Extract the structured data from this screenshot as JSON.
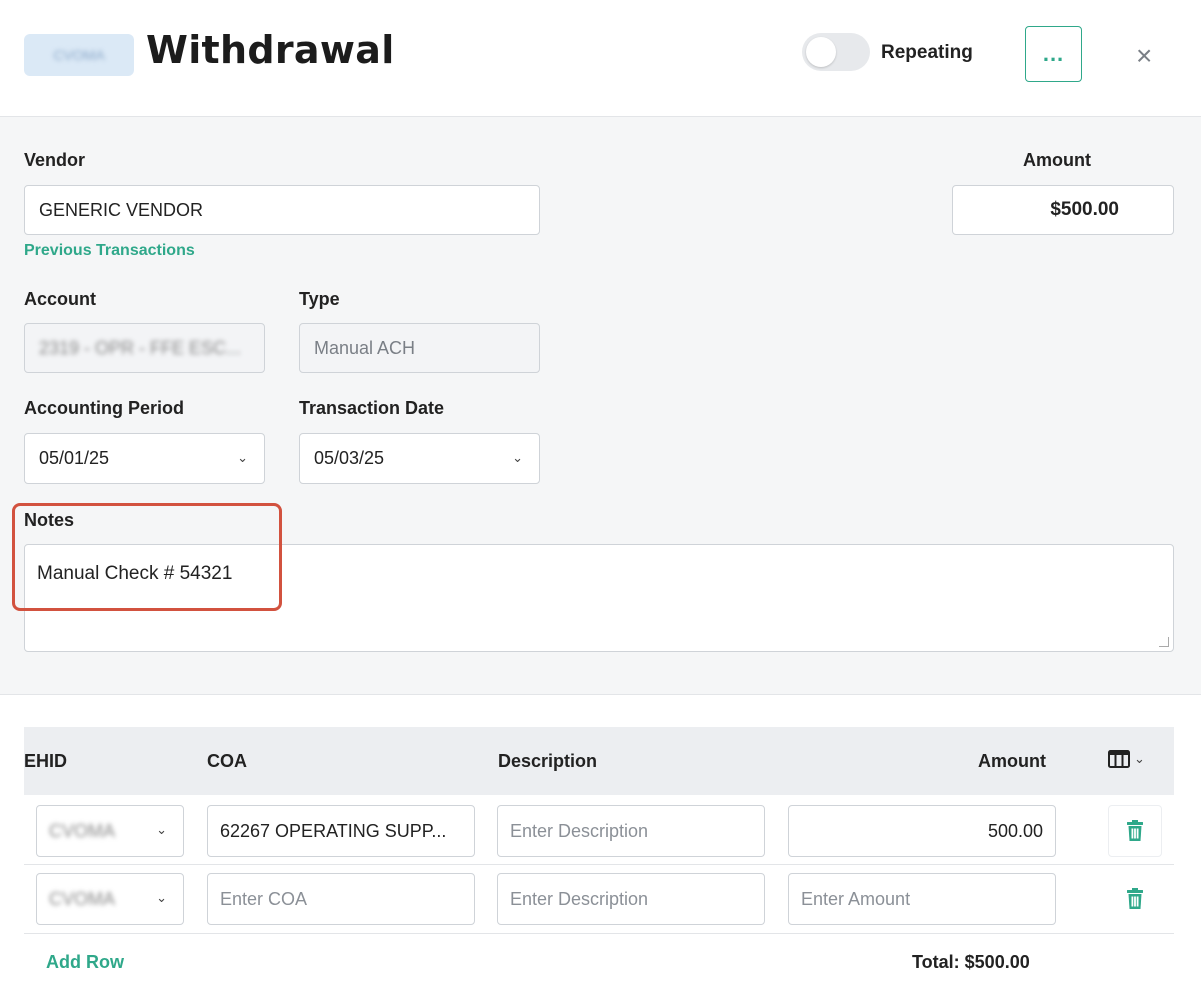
{
  "header": {
    "badge_text": "CVOMA",
    "title": "Withdrawal",
    "repeating_label": "Repeating",
    "repeating_on": false,
    "more_label": "...",
    "close_label": "×"
  },
  "form": {
    "vendor_label": "Vendor",
    "vendor_value": "GENERIC VENDOR",
    "previous_transactions": "Previous Transactions",
    "amount_label": "Amount",
    "amount_value": "$500.00",
    "account_label": "Account",
    "account_value": "2319 - OPR - FFE ESC...",
    "type_label": "Type",
    "type_value": "Manual ACH",
    "accounting_period_label": "Accounting Period",
    "accounting_period_value": "05/01/25",
    "transaction_date_label": "Transaction Date",
    "transaction_date_value": "05/03/25",
    "notes_label": "Notes",
    "notes_value": "Manual Check # 54321"
  },
  "table": {
    "headers": {
      "ehid": "EHID",
      "coa": "COA",
      "description": "Description",
      "amount": "Amount"
    },
    "rows": [
      {
        "ehid": "CVOMA",
        "coa": "62267 OPERATING SUPP...",
        "description_placeholder": "Enter Description",
        "amount": "500.00"
      },
      {
        "ehid": "CVOMA",
        "coa_placeholder": "Enter COA",
        "description_placeholder": "Enter Description",
        "amount_placeholder": "Enter Amount"
      }
    ],
    "add_row_label": "Add Row",
    "total_label": "Total: $500.00"
  },
  "colors": {
    "accent": "#2fa88a",
    "highlight": "#d2523f"
  }
}
